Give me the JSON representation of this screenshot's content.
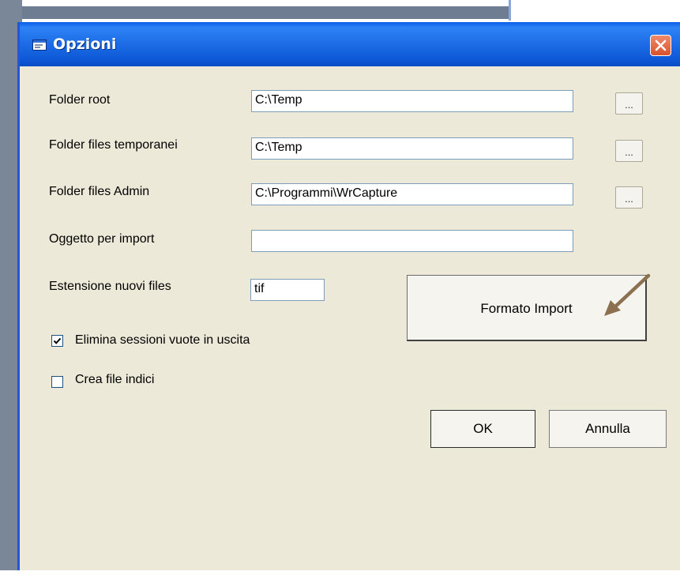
{
  "window": {
    "title": "Opzioni",
    "icon": "app-window-icon",
    "close_icon": "close-icon"
  },
  "fields": {
    "folder_root": {
      "label": "Folder root",
      "value": "C:\\Temp",
      "browse_label": "..."
    },
    "folder_temp": {
      "label": "Folder files temporanei",
      "value": "C:\\Temp",
      "browse_label": "..."
    },
    "folder_admin": {
      "label": "Folder files Admin",
      "value": "C:\\Programmi\\WrCapture",
      "browse_label": "..."
    },
    "oggetto_import": {
      "label": "Oggetto per import",
      "value": ""
    },
    "estensione": {
      "label": "Estensione nuovi files",
      "value": "tif"
    }
  },
  "checkboxes": {
    "elimina": {
      "label": "Elimina sessioni vuote in uscita",
      "checked": true
    },
    "crea_indici": {
      "label": "Crea file indici",
      "checked": false
    }
  },
  "buttons": {
    "formato_import": "Formato Import",
    "ok": "OK",
    "annulla": "Annulla"
  },
  "annotation": {
    "arrow_icon": "pointer-arrow-icon",
    "arrow_color": "#8b7150"
  },
  "colors": {
    "titlebar": "#1f6ee8",
    "dialog_bg": "#ece9d8",
    "close_button": "#e06a48"
  }
}
